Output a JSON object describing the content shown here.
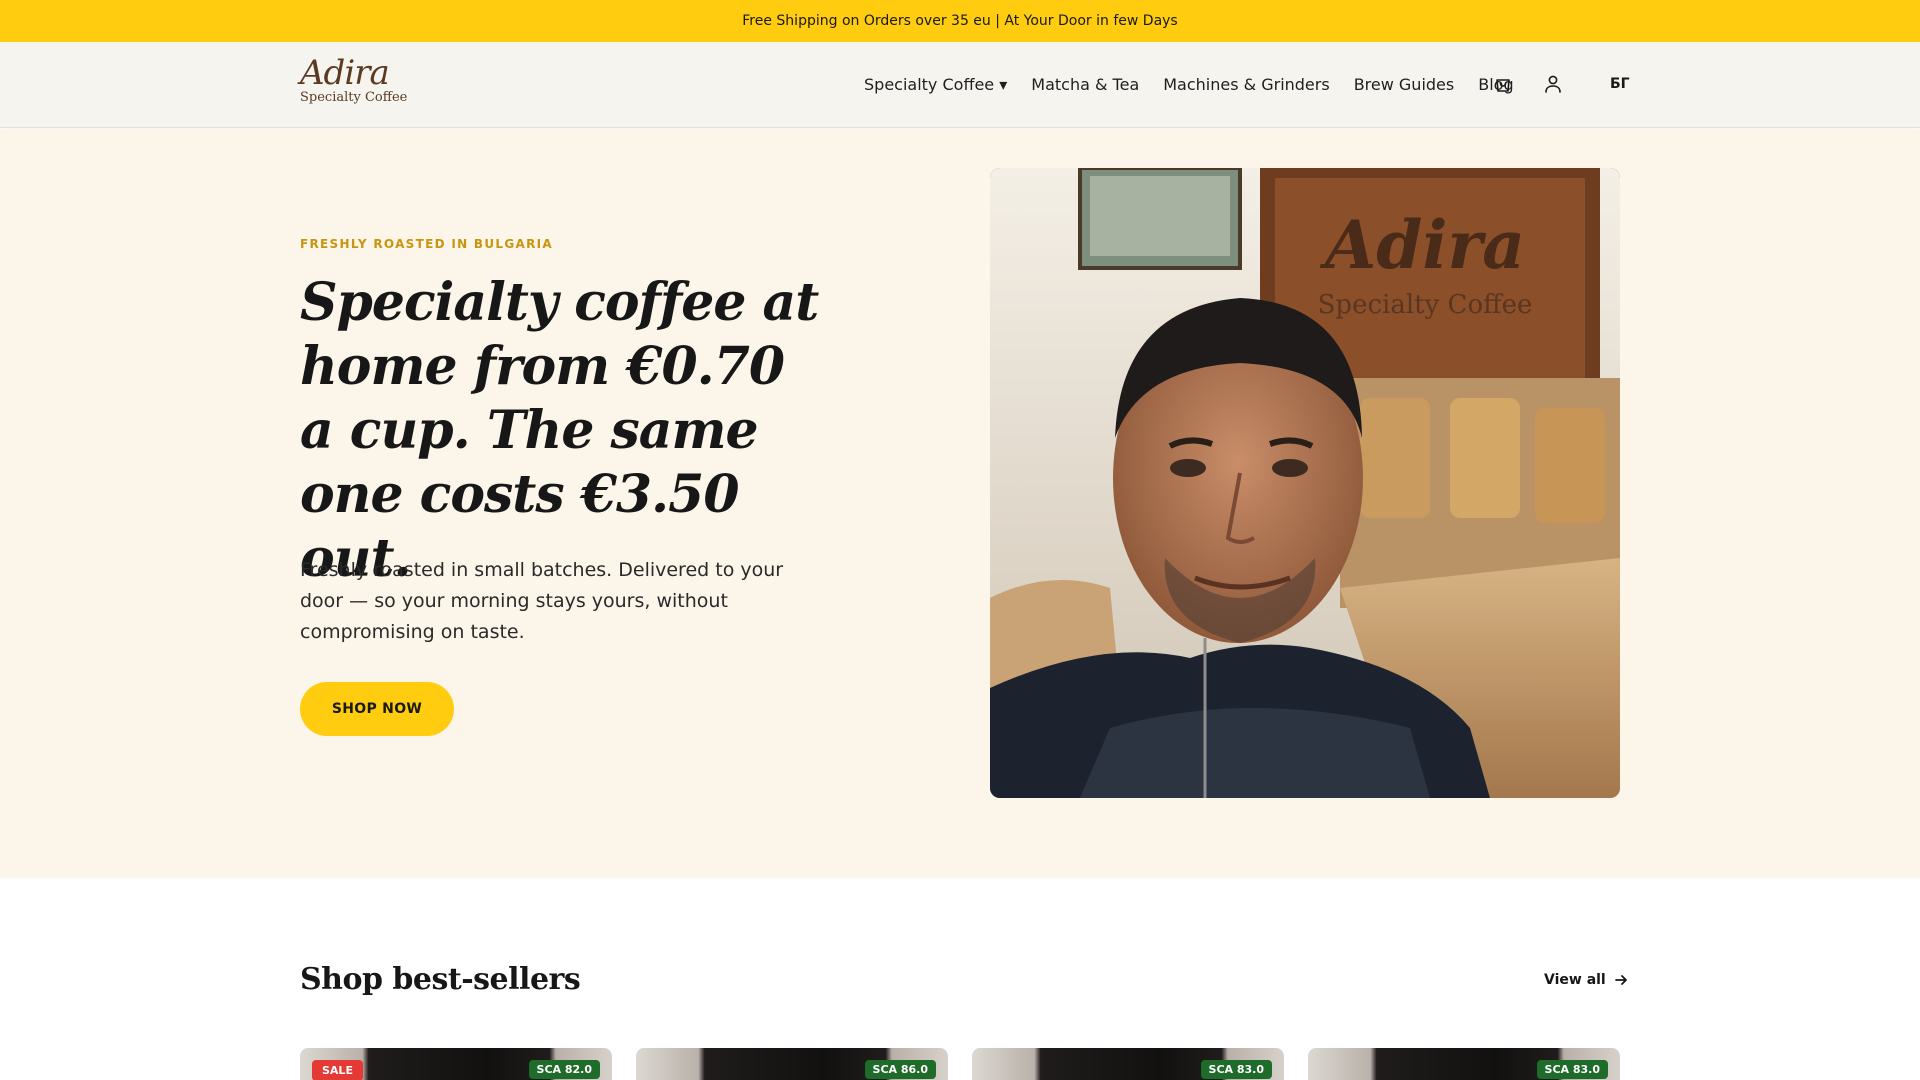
{
  "announcement": "Free Shipping on Orders over 35 eu | At Your Door in few Days",
  "brand": {
    "name": "Adira",
    "tagline": "Specialty Coffee"
  },
  "nav": {
    "items": [
      {
        "label": "Specialty Coffee ▾"
      },
      {
        "label": "Matcha & Tea"
      },
      {
        "label": "Machines & Grinders"
      },
      {
        "label": "Brew Guides"
      },
      {
        "label": "Blog"
      }
    ],
    "icons": [
      "cart-icon",
      "account-icon"
    ],
    "language": "БГ"
  },
  "hero": {
    "eyebrow": "FRESHLY ROASTED IN BULGARIA",
    "headline": "Specialty coffee at home from €0.70 a cup. The same one costs €3.50 out.",
    "lede": "Freshly roasted in small batches. Delivered to your door — so your morning stays yours, without compromising on taste.",
    "cta": "SHOP NOW",
    "photo_sign": {
      "brand": "Adira",
      "tagline": "Specialty Coffee"
    }
  },
  "bestsellers": {
    "title": "Shop best-sellers",
    "view_all": "View all",
    "products": [
      {
        "sale": "SALE",
        "sca": "SCA 82.0"
      },
      {
        "sale": "",
        "sca": "SCA 86.0"
      },
      {
        "sale": "",
        "sca": "SCA 83.0"
      },
      {
        "sale": "",
        "sca": "SCA 83.0"
      }
    ]
  },
  "colors": {
    "accent": "#ffcc0f",
    "hero_bg": "#fcf5e9",
    "eyebrow": "#c8950e",
    "brand_brown": "#5b3a22",
    "sca_badge": "#1f6b2a",
    "sale_badge": "#e53935"
  }
}
